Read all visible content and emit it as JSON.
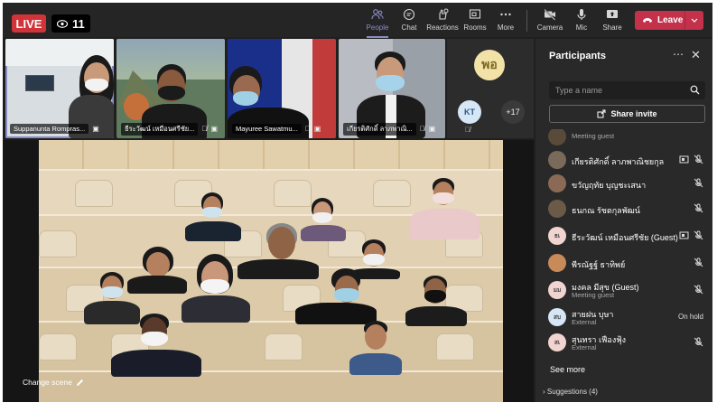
{
  "topbar": {
    "live_label": "LIVE",
    "viewer_count": "11",
    "buttons": [
      {
        "id": "people",
        "label": "People",
        "icon": "people-icon"
      },
      {
        "id": "chat",
        "label": "Chat",
        "icon": "chat-icon"
      },
      {
        "id": "reactions",
        "label": "Reactions",
        "icon": "reactions-icon"
      },
      {
        "id": "rooms",
        "label": "Rooms",
        "icon": "rooms-icon"
      },
      {
        "id": "more",
        "label": "More",
        "icon": "more-icon"
      },
      {
        "id": "camera",
        "label": "Camera",
        "icon": "camera-off-icon"
      },
      {
        "id": "mic",
        "label": "Mic",
        "icon": "mic-icon"
      },
      {
        "id": "share",
        "label": "Share",
        "icon": "share-icon"
      }
    ],
    "leave_label": "Leave"
  },
  "thumbnails": [
    {
      "name": "Suppanunta Rompras..."
    },
    {
      "name": "ธีระวัฒน์ เหมือนศรีชัย..."
    },
    {
      "name": "Mayuree Sawatmu..."
    },
    {
      "name": "เกียรติศักดิ์ ลาภพาณิ..."
    }
  ],
  "overflow": {
    "avatar1": "พอ",
    "avatar2": "KT",
    "more_count": "+17"
  },
  "stage": {
    "change_scene_label": "Change scene"
  },
  "panel": {
    "title": "Participants",
    "search_placeholder": "Type a name",
    "share_invite_label": "Share invite",
    "participants": [
      {
        "initials": "",
        "name": "",
        "sub": "Meeting guest",
        "status": "",
        "avatar_color": "#5a4a3a"
      },
      {
        "initials": "",
        "name": "เกียรติศักดิ์ ลาภพาณิชยกุล",
        "sub": "",
        "status": "",
        "avatar_color": "#7a6a5a"
      },
      {
        "initials": "",
        "name": "ขวัญฤทัย บุญชะเสนา",
        "sub": "",
        "status": "",
        "avatar_color": "#8a6a55"
      },
      {
        "initials": "",
        "name": "ธนกณ รัชตกุลพัฒน์",
        "sub": "",
        "status": "",
        "avatar_color": "#6b5a48"
      },
      {
        "initials": "ธเ",
        "name": "ธีระวัฒน์ เหมือนศรีชัย (Guest)",
        "sub": "",
        "status": "",
        "avatar_color": "#f1d4cf"
      },
      {
        "initials": "",
        "name": "พีรณัฐฐ์ ธาทิพย์",
        "sub": "",
        "status": "",
        "avatar_color": "#c98a5a"
      },
      {
        "initials": "มม",
        "name": "มงคล มีสุข (Guest)",
        "sub": "Meeting guest",
        "status": "",
        "avatar_color": "#f1d4cf"
      },
      {
        "initials": "สบ",
        "name": "สายฝน บุษา",
        "sub": "External",
        "status": "On hold",
        "avatar_color": "#d6e6f5"
      },
      {
        "initials": "สเ",
        "name": "สุนทรา เฟืองฟุ้ง",
        "sub": "External",
        "status": "",
        "avatar_color": "#f1d4cf"
      }
    ],
    "see_more_label": "See more",
    "suggestions_label": "Suggestions (4)"
  },
  "colors": {
    "live": "#d13438",
    "leave": "#c4314b",
    "accent": "#8b8cc7",
    "panel_bg": "#292929"
  }
}
